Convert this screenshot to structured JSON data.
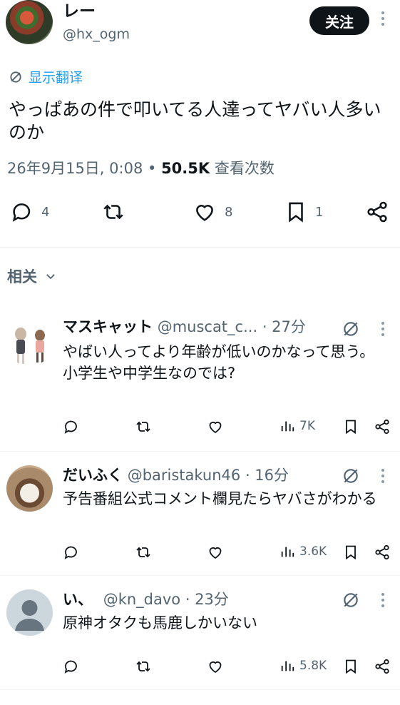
{
  "main": {
    "name": "レー",
    "handle": "@hx_ogm",
    "follow_label": "关注",
    "translate_label": "显示翻译",
    "text": "やっぱあの件で叩いてる人達ってヤバい人多いのか",
    "timestamp": "26年9月15日, 0:08",
    "views_count": "50.5K",
    "views_label": "查看次数",
    "reply_count": "4",
    "like_count": "8",
    "bookmark_count": "1"
  },
  "related": {
    "label": "相关"
  },
  "replies": [
    {
      "name": "マスキャット",
      "handle": "@muscat_c...",
      "time": "· 27分",
      "text_line1": "やばい人ってより年齢が低いのかなって思う。",
      "text_line2": "小学生や中学生なのでは?",
      "views": "7K"
    },
    {
      "name": "だいふく",
      "handle": "@baristakun46",
      "time": "· 16分",
      "text_line1": "予告番組公式コメント欄見たらヤバさがわかる",
      "text_line2": "",
      "views": "3.6K"
    },
    {
      "name": "い、",
      "handle": "@kn_davo",
      "time": "· 23分",
      "text_line1": "原神オタクも馬鹿しかいない",
      "text_line2": "",
      "views": "5.8K"
    }
  ],
  "colors": {
    "link": "#1d9bf0",
    "secondary": "#536471",
    "primary": "#0f1419"
  }
}
